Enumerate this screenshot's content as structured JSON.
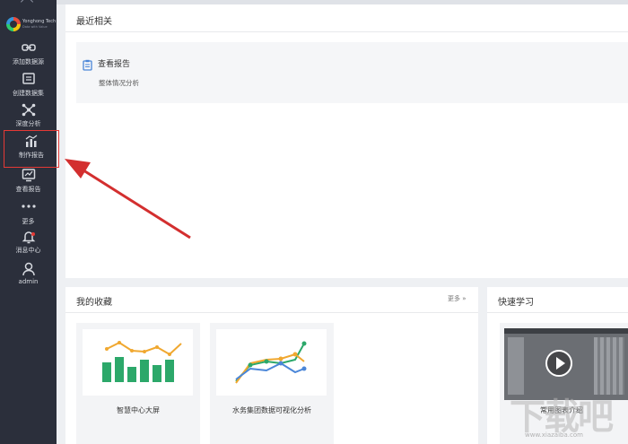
{
  "sidebar": {
    "brand": "Yonghong Tech",
    "tagline": "Data with Value",
    "items": [
      {
        "label": "添加数据源",
        "icon": "link-icon"
      },
      {
        "label": "创建数据集",
        "icon": "dataset-icon"
      },
      {
        "label": "深度分析",
        "icon": "deep-analysis-icon"
      },
      {
        "label": "制作报告",
        "icon": "chart-icon"
      },
      {
        "label": "查看报告",
        "icon": "view-report-icon"
      },
      {
        "label": "更多",
        "icon": "more-dots-icon"
      },
      {
        "label": "消息中心",
        "icon": "bell-icon"
      },
      {
        "label": "admin",
        "icon": "user-icon"
      }
    ],
    "active_item": "制作报告"
  },
  "recent": {
    "title": "最近相关",
    "report_title": "查看报告",
    "report_subtitle": "整体情况分析"
  },
  "favorites": {
    "title": "我的收藏",
    "more_label": "更多 »",
    "cards": [
      {
        "label": "智慧中心大屏"
      },
      {
        "label": "水务集团数据可视化分析"
      }
    ]
  },
  "quick_learn": {
    "title": "快速学习",
    "video_label": "常用图表介绍"
  },
  "watermark": {
    "text": "下载吧",
    "url": "www.xiazaiba.com"
  },
  "colors": {
    "sidebar_bg": "#2b2f3b",
    "highlight": "#e53935",
    "bar_green": "#2ca86a",
    "line_orange": "#f0a830",
    "line_blue": "#4a86d8"
  }
}
